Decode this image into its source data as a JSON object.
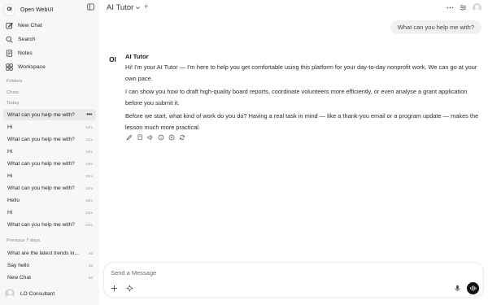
{
  "app": {
    "logo_text": "OI",
    "name": "Open WebUI"
  },
  "nav": [
    {
      "label": "New Chat",
      "icon": "pencil-square-icon"
    },
    {
      "label": "Search",
      "icon": "search-icon"
    },
    {
      "label": "Notes",
      "icon": "notes-icon"
    },
    {
      "label": "Workspace",
      "icon": "workspace-icon"
    }
  ],
  "sections": {
    "folders": "Folders",
    "chats": "Chats",
    "today": "Today",
    "previous": "Previous 7 days"
  },
  "chats_today": [
    {
      "title": "What can you help me with?",
      "time": "",
      "active": true,
      "more": "•••"
    },
    {
      "title": "Hi",
      "time": "10m"
    },
    {
      "title": "What can you help me with?",
      "time": "11m"
    },
    {
      "title": "Hi",
      "time": "13m"
    },
    {
      "title": "What can you help me with?",
      "time": "13m"
    },
    {
      "title": "Hi",
      "time": "15m"
    },
    {
      "title": "What can you help me with?",
      "time": "16m"
    },
    {
      "title": "Hello",
      "time": "18m"
    },
    {
      "title": "Hi",
      "time": "21m"
    },
    {
      "title": "What can you help me with?",
      "time": "21m"
    }
  ],
  "chats_previous": [
    {
      "title": "What are the latest trends in...",
      "time": "4d"
    },
    {
      "title": "Say hello",
      "time": "4d"
    },
    {
      "title": "New Chat",
      "time": "5d"
    }
  ],
  "user": {
    "name": "LO Consultant"
  },
  "header": {
    "model": "AI Tutor",
    "add": "+"
  },
  "conversation": {
    "user_message": "What can you help me with?",
    "assistant_avatar": "OI",
    "assistant_name": "AI Tutor",
    "paragraphs": [
      "Hi! I'm your AI Tutor — I'm here to help you get comfortable using this platform for your day-to-day nonprofit work. We can go at your own pace.",
      "I can show you how to draft high-quality board reports, coordinate volunteers more efficiently, or even analyse a grant application before you submit it.",
      "Before we start, what kind of work do you do? Having a real task in mind — like a thank-you email or a program update — makes the lesson much more practical."
    ]
  },
  "composer": {
    "placeholder": "Send a Message"
  }
}
